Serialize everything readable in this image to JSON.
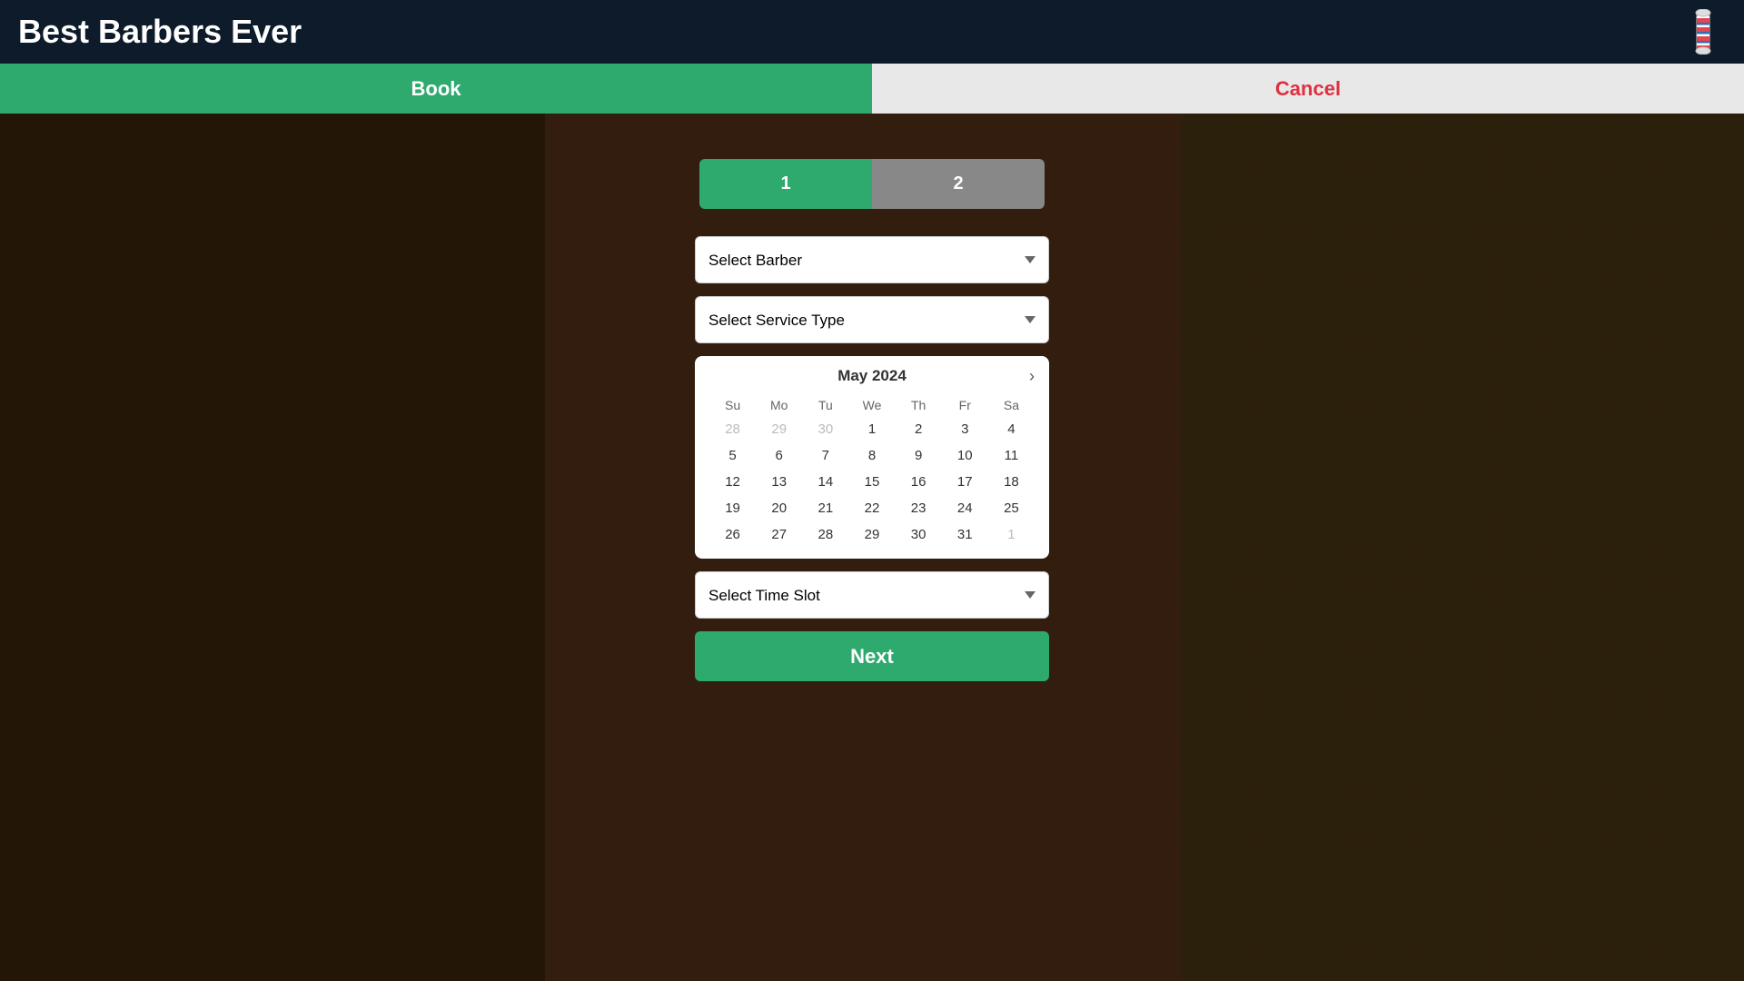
{
  "header": {
    "title": "Best Barbers Ever",
    "logo_icon": "barber-pole"
  },
  "nav": {
    "book_label": "Book",
    "cancel_label": "Cancel"
  },
  "steps": {
    "step1_label": "1",
    "step2_label": "2"
  },
  "form": {
    "barber_placeholder": "Select Barber",
    "service_placeholder": "Select Service Type",
    "timeslot_placeholder": "Select Time Slot",
    "next_label": "Next"
  },
  "calendar": {
    "title": "May 2024",
    "days_header": [
      "Su",
      "Mo",
      "Tu",
      "We",
      "Th",
      "Fr",
      "Sa"
    ],
    "weeks": [
      [
        "28",
        "29",
        "30",
        "1",
        "2",
        "3",
        "4"
      ],
      [
        "5",
        "6",
        "7",
        "8",
        "9",
        "10",
        "11"
      ],
      [
        "12",
        "13",
        "14",
        "15",
        "16",
        "17",
        "18"
      ],
      [
        "19",
        "20",
        "21",
        "22",
        "23",
        "24",
        "25"
      ],
      [
        "26",
        "27",
        "28",
        "29",
        "30",
        "31",
        "1"
      ]
    ],
    "other_month_indices": {
      "row0": [
        0,
        1,
        2
      ],
      "row4": [
        6
      ]
    }
  },
  "colors": {
    "green": "#2eaa6e",
    "dark_navy": "#0d1b2a",
    "cancel_red": "#e03040",
    "inactive_gray": "#888888"
  }
}
